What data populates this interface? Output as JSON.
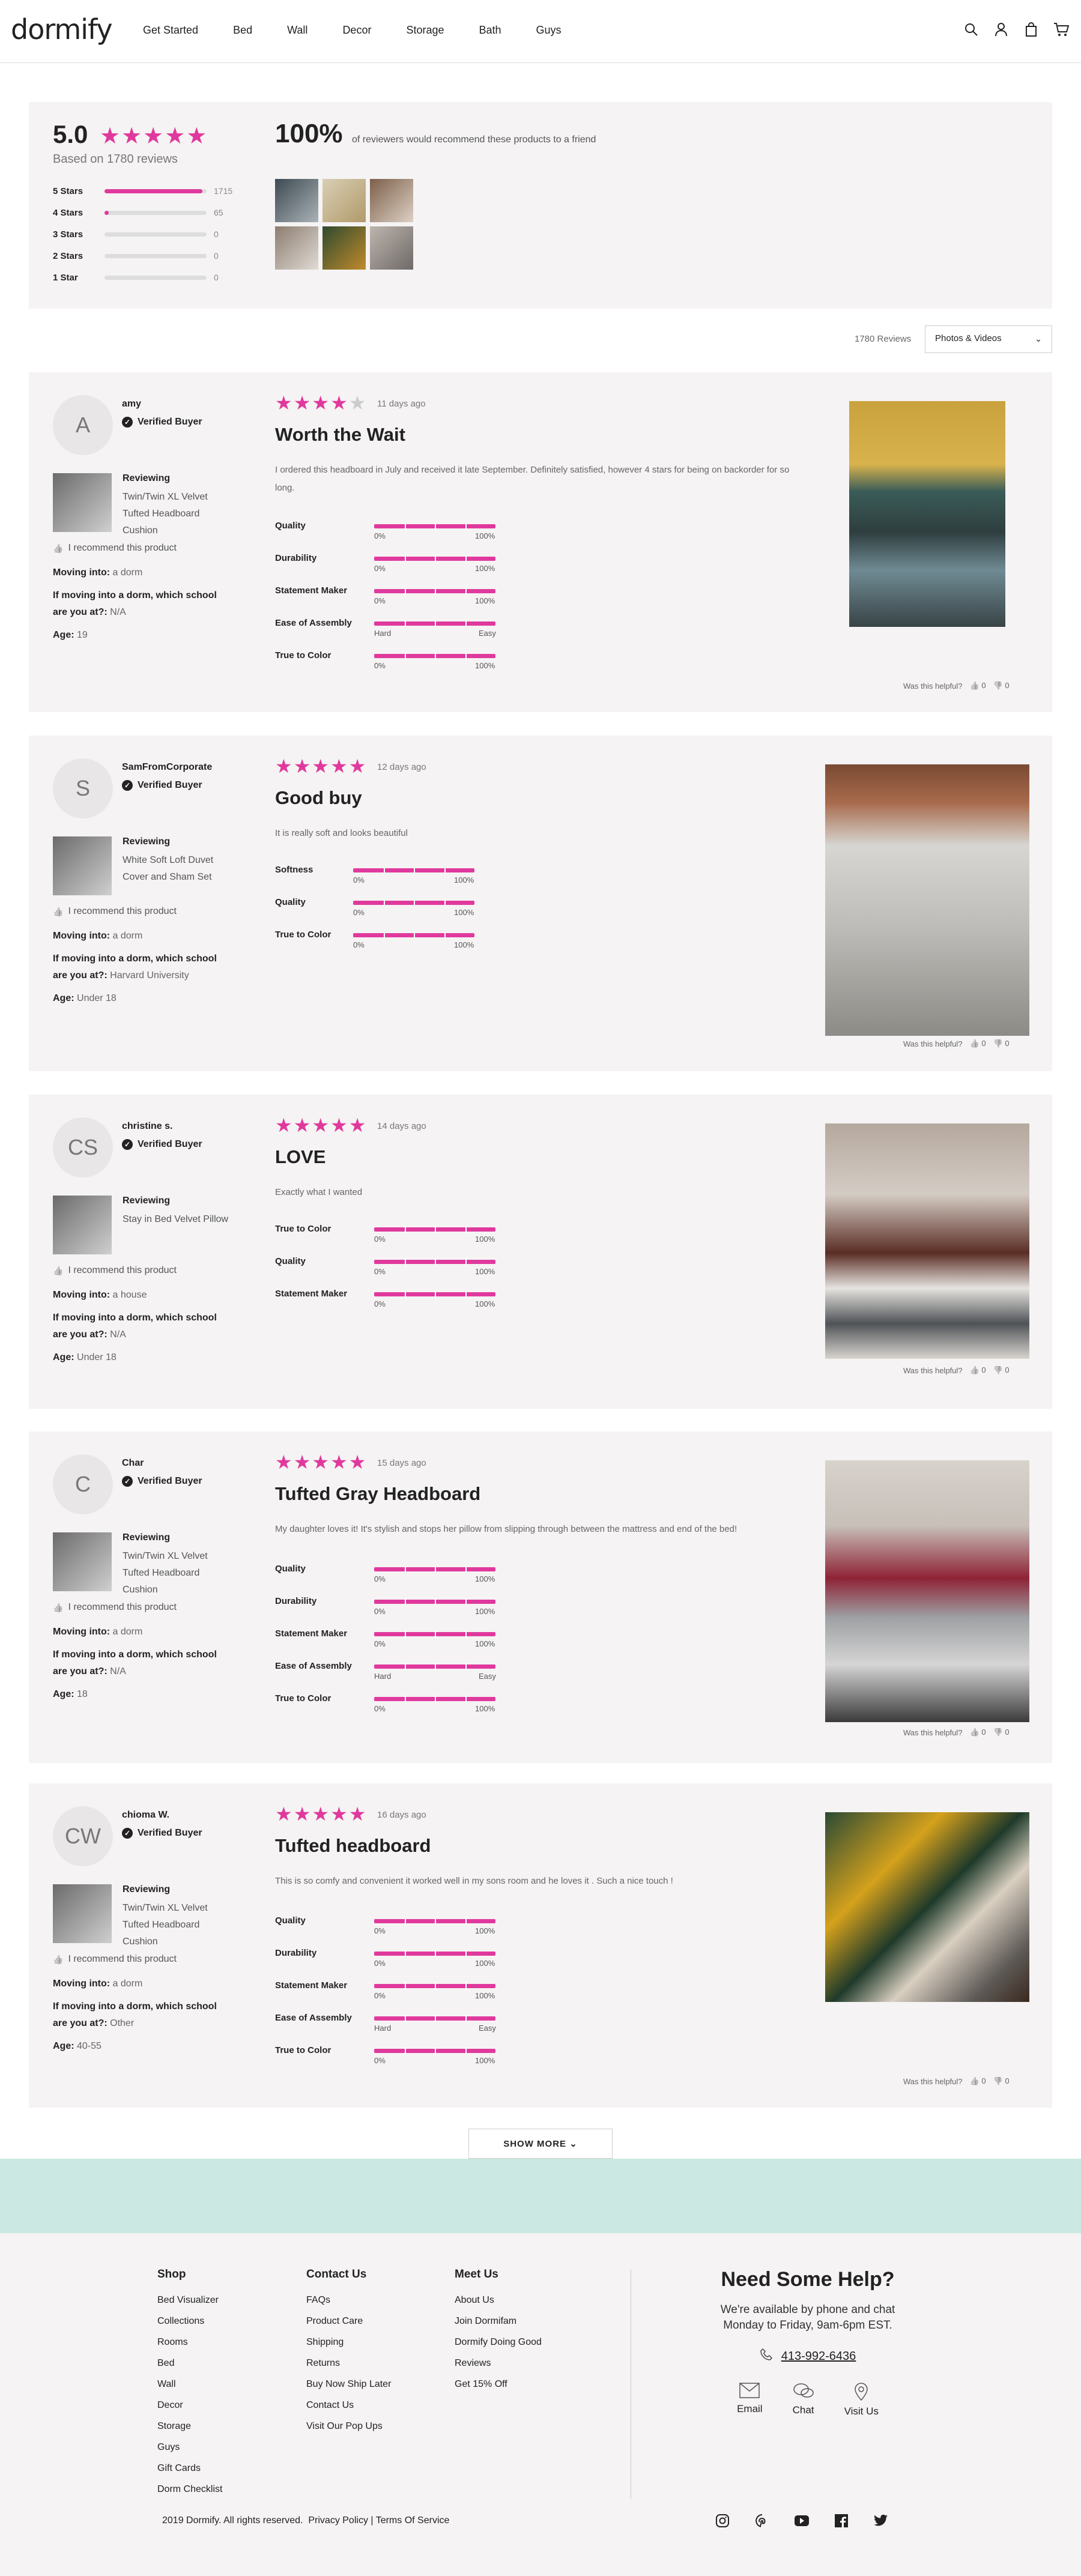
{
  "header": {
    "logo": "dormify",
    "nav": [
      "Get Started",
      "Bed",
      "Wall",
      "Decor",
      "Storage",
      "Bath",
      "Guys"
    ]
  },
  "summary": {
    "score": "5.0",
    "based": "Based on 1780 reviews",
    "dist": [
      {
        "label": "5 Stars",
        "count": "1715",
        "fill": 0.96
      },
      {
        "label": "4 Stars",
        "count": "65",
        "fill": 0.04
      },
      {
        "label": "3 Stars",
        "count": "0",
        "fill": 0
      },
      {
        "label": "2 Stars",
        "count": "0",
        "fill": 0
      },
      {
        "label": "1 Star",
        "count": "0",
        "fill": 0
      }
    ],
    "recommend_pct": "100%",
    "recommend_text": "of reviewers would recommend these products to a friend"
  },
  "controls": {
    "count": "1780 Reviews",
    "filter": "Photos & Videos"
  },
  "reviews": [
    {
      "initials": "A",
      "user": "amy",
      "verified": "Verified Buyer",
      "reviewing": "Reviewing",
      "product": "Twin/Twin XL Velvet Tufted Headboard Cushion",
      "recommend": "I recommend this product",
      "moving_label": "Moving into:",
      "moving": " a dorm",
      "school_label": "If moving into a dorm, which school are you at?:",
      "school": " N/A",
      "age_label": "Age:",
      "age": " 19",
      "rating": 4,
      "date": "11 days ago",
      "title": "Worth the Wait",
      "body": "I ordered this headboard in July and received it late September. Definitely satisfied, however 4 stars for being on backorder for so long.",
      "metrics": [
        "Quality",
        "Durability",
        "Statement Maker",
        "Ease of Assembly",
        "True to Color"
      ],
      "helpful": "Was this helpful?",
      "up": "0",
      "down": "0"
    },
    {
      "initials": "S",
      "user": "SamFromCorporate",
      "verified": "Verified Buyer",
      "reviewing": "Reviewing",
      "product": "White Soft Loft Duvet Cover and Sham Set",
      "recommend": "I recommend this product",
      "moving_label": "Moving into:",
      "moving": " a dorm",
      "school_label": "If moving into a dorm, which school are you at?:",
      "school": " Harvard University",
      "age_label": "Age:",
      "age": " Under 18",
      "rating": 5,
      "date": "12 days ago",
      "title": "Good buy",
      "body": "It is really soft and looks beautiful",
      "metrics": [
        "Softness",
        "Quality",
        "True to Color"
      ],
      "helpful": "Was this helpful?",
      "up": "0",
      "down": "0"
    },
    {
      "initials": "CS",
      "user": "christine s.",
      "verified": "Verified Buyer",
      "reviewing": "Reviewing",
      "product": "Stay in Bed Velvet Pillow",
      "recommend": "I recommend this product",
      "moving_label": "Moving into:",
      "moving": " a house",
      "school_label": "If moving into a dorm, which school are you at?:",
      "school": " N/A",
      "age_label": "Age:",
      "age": " Under 18",
      "rating": 5,
      "date": "14 days ago",
      "title": "LOVE",
      "body": "Exactly what I wanted",
      "metrics": [
        "True to Color",
        "Quality",
        "Statement Maker"
      ],
      "helpful": "Was this helpful?",
      "up": "0",
      "down": "0"
    },
    {
      "initials": "C",
      "user": "Char",
      "verified": "Verified Buyer",
      "reviewing": "Reviewing",
      "product": "Twin/Twin XL Velvet Tufted Headboard Cushion",
      "recommend": "I recommend this product",
      "moving_label": "Moving into:",
      "moving": " a dorm",
      "school_label": "If moving into a dorm, which school are you at?:",
      "school": " N/A",
      "age_label": "Age:",
      "age": " 18",
      "rating": 5,
      "date": "15 days ago",
      "title": "Tufted Gray Headboard",
      "body": "My daughter loves it! It's stylish and stops her pillow from slipping through between the mattress and end of the bed!",
      "metrics": [
        "Quality",
        "Durability",
        "Statement Maker",
        "Ease of Assembly",
        "True to Color"
      ],
      "helpful": "Was this helpful?",
      "up": "0",
      "down": "0"
    },
    {
      "initials": "CW",
      "user": "chioma W.",
      "verified": "Verified Buyer",
      "reviewing": "Reviewing",
      "product": "Twin/Twin XL Velvet Tufted Headboard Cushion",
      "recommend": "I recommend this product",
      "moving_label": "Moving into:",
      "moving": " a dorm",
      "school_label": "If moving into a dorm, which school are you at?:",
      "school": " Other",
      "age_label": "Age:",
      "age": " 40-55",
      "rating": 5,
      "date": "16 days ago",
      "title": "Tufted headboard",
      "body": "This is so comfy and convenient it worked well in my sons room and he loves it . Such a nice touch !",
      "metrics": [
        "Quality",
        "Durability",
        "Statement Maker",
        "Ease of Assembly",
        "True to Color"
      ],
      "helpful": "Was this helpful?",
      "up": "0",
      "down": "0"
    }
  ],
  "scale": {
    "lo": "0%",
    "hi": "100%",
    "hard": "Hard",
    "easy": "Easy"
  },
  "show_more": "SHOW MORE",
  "footer": {
    "shop": {
      "title": "Shop",
      "items": [
        "Bed Visualizer",
        "Collections",
        "Rooms",
        "Bed",
        "Wall",
        "Decor",
        "Storage",
        "Guys",
        "Gift Cards",
        "Dorm Checklist"
      ]
    },
    "contact": {
      "title": "Contact Us",
      "items": [
        "FAQs",
        "Product Care",
        "Shipping",
        "Returns",
        "Buy Now Ship Later",
        "Contact Us",
        "Visit Our Pop Ups"
      ]
    },
    "meet": {
      "title": "Meet Us",
      "items": [
        "About Us",
        "Join Dormifam",
        "Dormify Doing Good",
        "Reviews",
        "Get 15% Off"
      ]
    },
    "help_title": "Need Some Help?",
    "help_text1": "We're available by phone and chat",
    "help_text2": "Monday to Friday, 9am-6pm EST.",
    "phone": "413-992-6436",
    "actions": [
      "Email",
      "Chat",
      "Visit Us"
    ],
    "copyright": "2019 Dormify. All rights reserved.",
    "privacy": "Privacy Policy",
    "terms": "| Terms Of Service"
  },
  "colors": {
    "accent": "#e0399d",
    "mint": "#cce8e2",
    "panel": "#f5f3f3"
  }
}
